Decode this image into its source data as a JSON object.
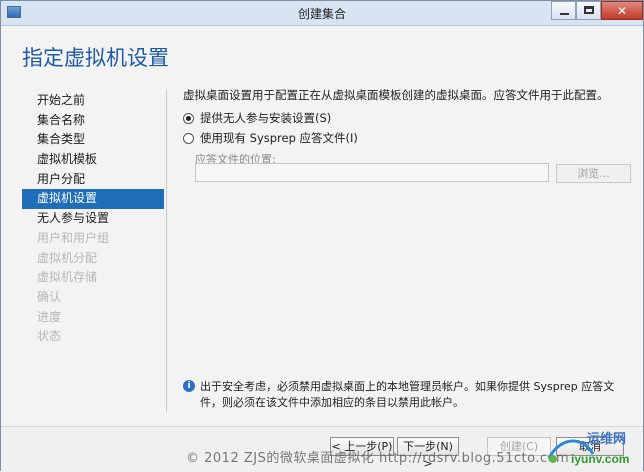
{
  "window": {
    "title": "创建集合"
  },
  "page": {
    "title": "指定虚拟机设置"
  },
  "nav": {
    "items": [
      {
        "label": "开始之前",
        "state": "normal"
      },
      {
        "label": "集合名称",
        "state": "normal"
      },
      {
        "label": "集合类型",
        "state": "normal"
      },
      {
        "label": "虚拟机模板",
        "state": "normal"
      },
      {
        "label": "用户分配",
        "state": "normal"
      },
      {
        "label": "虚拟机设置",
        "state": "active"
      },
      {
        "label": "无人参与设置",
        "state": "normal"
      },
      {
        "label": "用户和用户组",
        "state": "disabled"
      },
      {
        "label": "虚拟机分配",
        "state": "disabled"
      },
      {
        "label": "虚拟机存储",
        "state": "disabled"
      },
      {
        "label": "确认",
        "state": "disabled"
      },
      {
        "label": "进度",
        "state": "disabled"
      },
      {
        "label": "状态",
        "state": "disabled"
      }
    ]
  },
  "content": {
    "description": "虚拟桌面设置用于配置正在从虚拟桌面模板创建的虚拟桌面。应答文件用于此配置。",
    "option_unattended": "提供无人参与安装设置(S)",
    "option_sysprep": "使用现有 Sysprep 应答文件(I)",
    "answer_file_label": "应答文件的位置:",
    "answer_file_value": "",
    "browse_label": "浏览..."
  },
  "info": {
    "text": "出于安全考虑，必须禁用虚拟桌面上的本地管理员帐户。如果你提供 Sysprep 应答文件，则必须在该文件中添加相应的条目以禁用此帐户。"
  },
  "buttons": {
    "previous": "< 上一步(P)",
    "next": "下一步(N) >",
    "create": "创建(C)",
    "cancel": "取消"
  },
  "watermark": {
    "text": "© 2012 ZJS的微软桌面虚拟化 http://rdsrv.blog.51cto.com",
    "logo_text": "运维网",
    "logo_url": "iyunv.com"
  },
  "colors": {
    "accent": "#1f6fb8",
    "title": "#1f5aa6",
    "info_icon": "#2d6fc2"
  }
}
